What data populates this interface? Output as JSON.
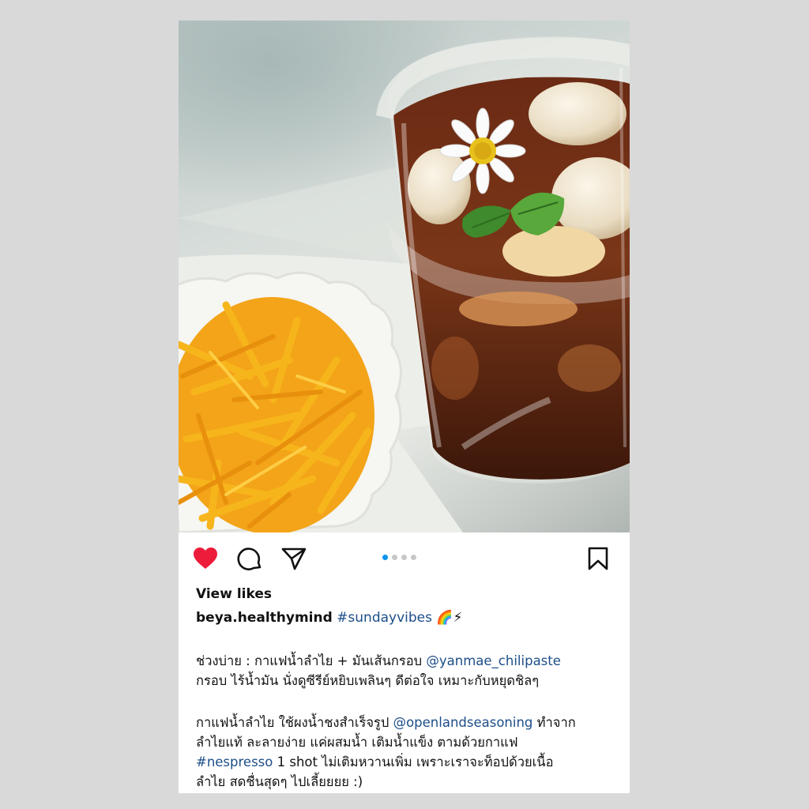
{
  "post": {
    "view_likes_label": "View likes",
    "username": "beya.healthymind",
    "hashtag": "#sundayvibes",
    "emoji": "🌈⚡",
    "paragraph1": {
      "line1_text": "ช่วงบ่าย :  กาแฟน้ำลำไย + มันเส้นกรอบ ",
      "line1_mention": "@yanmae_chilipaste",
      "line2_text": "กรอบ ไร้น้ำมัน นั่งดูซีรีย์หยิบเพลินๆ ดีต่อใจ เหมาะกับหยุดชิลๆ"
    },
    "paragraph2": {
      "line1_text": "กาแฟน้ำลำไย ใช้ผงน้ำชงสำเร็จรูป ",
      "line1_mention": "@openlandseasoning",
      "line1_rest": " ทำจาก",
      "line2_text": "ลำไยแท้ ละลายง่าย แค่ผสมน้ำ เติมน้ำแข็ง ตามด้วยกาแฟ",
      "line3_tag": "#nespresso",
      "line3_text": " 1 shot ไม่เติมหวานเพิ่ม เพราะเราจะท็อปด้วยเนื้อ",
      "line4_text": "ลำไย สดชื่นสุดๆ ไปเลี้ยยยย :)"
    }
  },
  "actions": {
    "like_icon": "heart-filled-icon",
    "comment_icon": "comment-icon",
    "share_icon": "paper-plane-icon",
    "save_icon": "bookmark-icon",
    "liked": true,
    "like_color": "#ed1c3a"
  },
  "carousel": {
    "total": 4,
    "active_index": 0,
    "active_color": "#0a95f0"
  },
  "colors": {
    "link": "#1d4e89",
    "background": "#d9d9d9"
  }
}
